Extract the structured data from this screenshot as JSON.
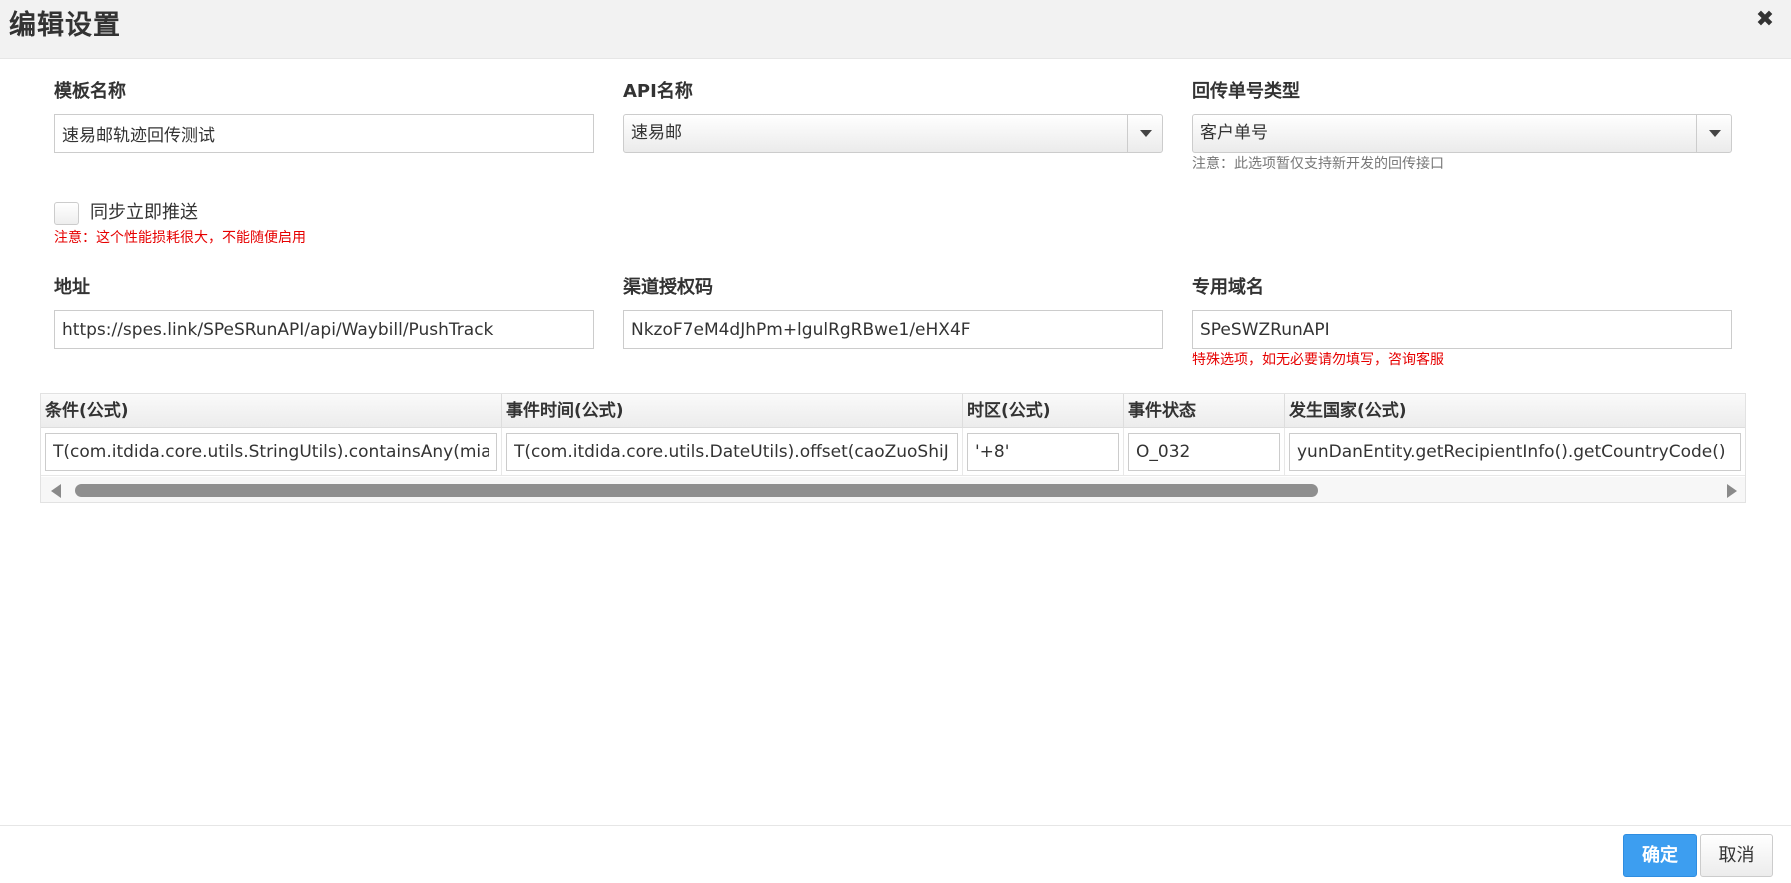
{
  "dialog": {
    "title": "编辑设置",
    "close_symbol": "✖"
  },
  "form": {
    "template_name": {
      "label": "模板名称",
      "value": "速易邮轨迹回传测试"
    },
    "api_name": {
      "label": "API名称",
      "selected": "速易邮"
    },
    "return_number_type": {
      "label": "回传单号类型",
      "selected": "客户单号",
      "note": "注意：此选项暂仅支持新开发的回传接口"
    },
    "sync_push": {
      "label": "同步立即推送",
      "checked": false,
      "warning": "注意：这个性能损耗很大，不能随便启用"
    },
    "address": {
      "label": "地址",
      "value": "https://spes.link/SPeSRunAPI/api/Waybill/PushTrack"
    },
    "channel_auth_code": {
      "label": "渠道授权码",
      "value": "NkzoF7eM4dJhPm+lgulRgRBwe1/eHX4F"
    },
    "dedicated_domain": {
      "label": "专用域名",
      "value": "SPeSWZRunAPI",
      "warning": "特殊选项，如无必要请勿填写，咨询客服"
    }
  },
  "grid": {
    "columns": [
      "条件(公式)",
      "事件时间(公式)",
      "时区(公式)",
      "事件状态",
      "发生国家(公式)"
    ],
    "rows": [
      {
        "condition": "T(com.itdida.core.utils.StringUtils).containsAny(miaoShu",
        "event_time": "T(com.itdida.core.utils.DateUtils).offset(caoZuoShiJian,",
        "timezone": "'+8'",
        "event_status": "O_032",
        "country": "yunDanEntity.getRecipientInfo().getCountryCode()"
      }
    ],
    "scroll_fraction": 0.73
  },
  "footer": {
    "ok_label": "确定",
    "cancel_label": "取消"
  },
  "colors": {
    "primary": "#3d9ef0",
    "warning": "#e60000",
    "header_bg": "#f2f2f2"
  },
  "icons": {
    "close": "close-icon",
    "dropdown": "chevron-down-icon",
    "scroll_left": "arrow-left-icon",
    "scroll_right": "arrow-right-icon"
  }
}
